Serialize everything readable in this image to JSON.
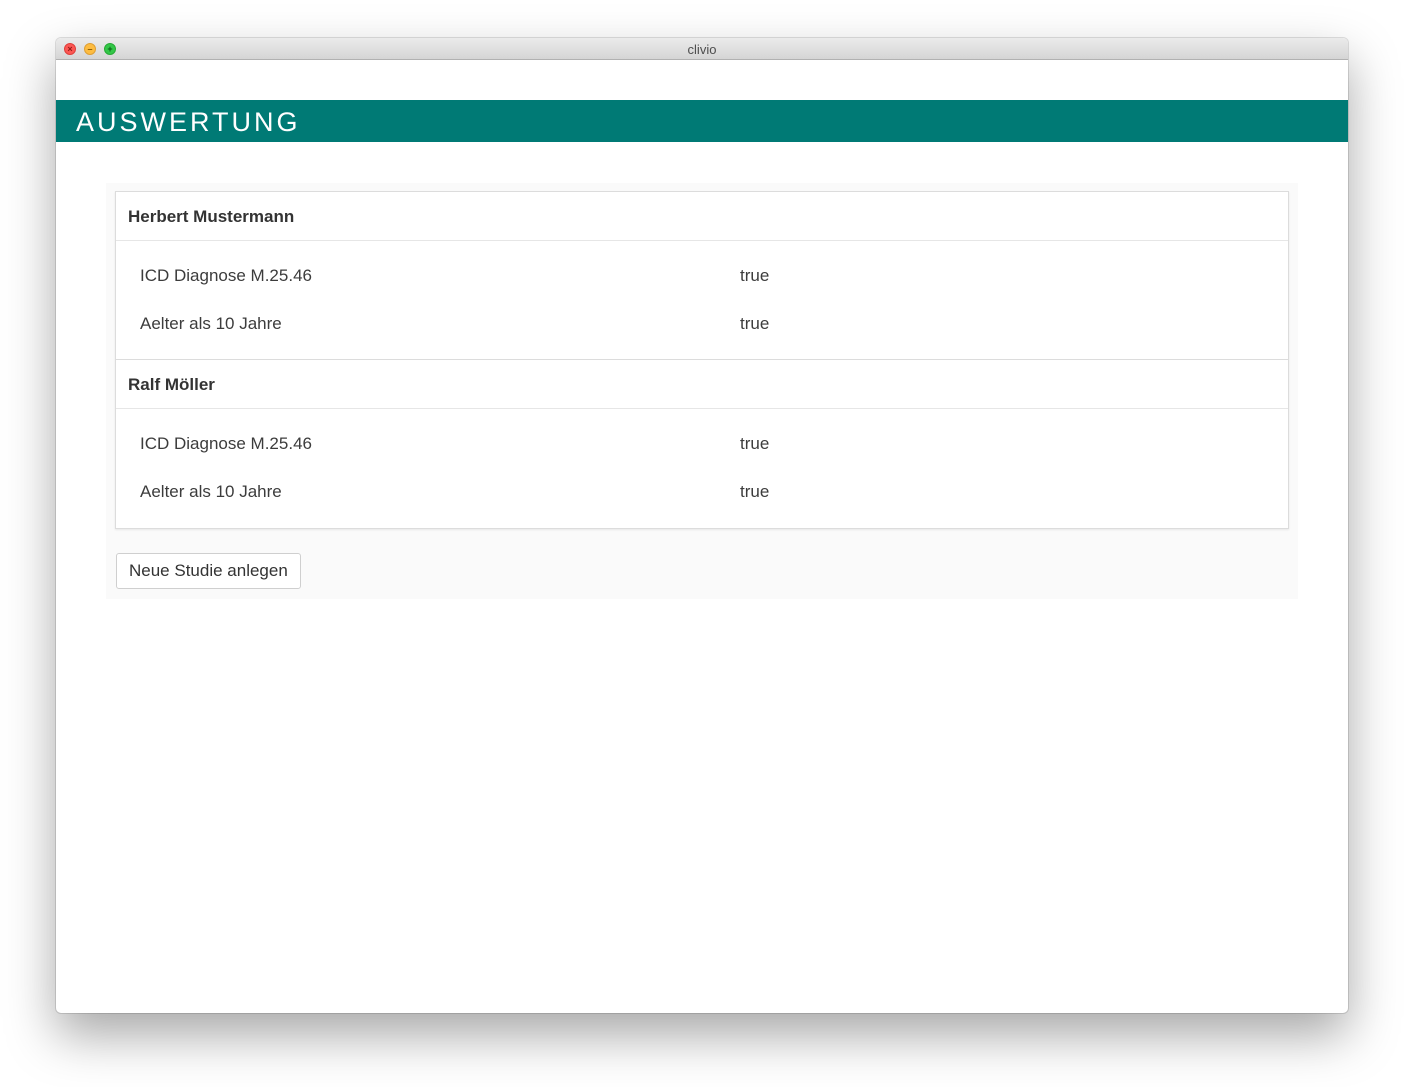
{
  "window": {
    "title": "clivio",
    "close_glyph": "×",
    "minimize_glyph": "–",
    "zoom_glyph": "+"
  },
  "header": {
    "title": "AUSWERTUNG",
    "color": "#007a75"
  },
  "results": [
    {
      "patient": "Herbert Mustermann",
      "criteria": [
        {
          "label": "ICD Diagnose M.25.46",
          "value": "true"
        },
        {
          "label": "Aelter als 10 Jahre",
          "value": "true"
        }
      ]
    },
    {
      "patient": "Ralf Möller",
      "criteria": [
        {
          "label": "ICD Diagnose M.25.46",
          "value": "true"
        },
        {
          "label": "Aelter als 10 Jahre",
          "value": "true"
        }
      ]
    }
  ],
  "actions": {
    "new_study_label": "Neue Studie anlegen"
  }
}
